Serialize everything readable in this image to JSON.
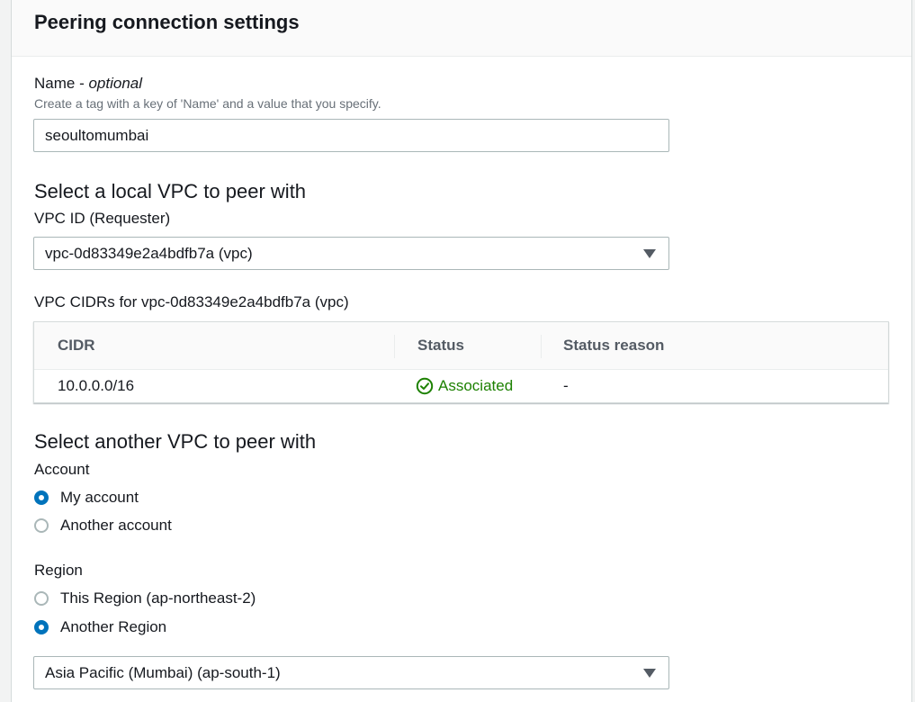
{
  "panel": {
    "title": "Peering connection settings"
  },
  "name_field": {
    "label": "Name",
    "label_suffix": "optional",
    "label_separator": " - ",
    "description": "Create a tag with a key of 'Name' and a value that you specify.",
    "value": "seoultomumbai"
  },
  "local_vpc": {
    "section_title": "Select a local VPC to peer with",
    "vpc_id_label": "VPC ID (Requester)",
    "vpc_id_value": "vpc-0d83349e2a4bdfb7a (vpc)",
    "cidrs_label": "VPC CIDRs for vpc-0d83349e2a4bdfb7a (vpc)",
    "table": {
      "columns": [
        "CIDR",
        "Status",
        "Status reason"
      ],
      "rows": [
        {
          "cidr": "10.0.0.0/16",
          "status": "Associated",
          "status_reason": "-"
        }
      ]
    }
  },
  "peer_vpc": {
    "section_title": "Select another VPC to peer with",
    "account_label": "Account",
    "account_options": [
      {
        "label": "My account",
        "checked": true
      },
      {
        "label": "Another account",
        "checked": false
      }
    ],
    "region_label": "Region",
    "region_options": [
      {
        "label": "This Region (ap-northeast-2)",
        "checked": false
      },
      {
        "label": "Another Region",
        "checked": true
      }
    ],
    "region_select_value": "Asia Pacific (Mumbai) (ap-south-1)"
  },
  "colors": {
    "accent": "#0073bb",
    "success": "#1d8102",
    "border": "#aab7b8"
  },
  "icons": {
    "status": "check-circle-icon",
    "dropdown": "caret-down-icon"
  }
}
